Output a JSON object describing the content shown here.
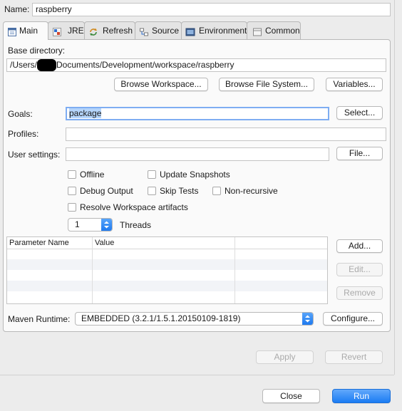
{
  "name": {
    "label": "Name:",
    "value": "raspberry"
  },
  "tabs": [
    {
      "label": "Main",
      "icon": "main-tab-icon"
    },
    {
      "label": "JRE",
      "icon": "jre-icon"
    },
    {
      "label": "Refresh",
      "icon": "refresh-icon"
    },
    {
      "label": "Source",
      "icon": "source-icon"
    },
    {
      "label": "Environment",
      "icon": "environment-icon"
    },
    {
      "label": "Common",
      "icon": "common-icon"
    }
  ],
  "base_dir": {
    "label": "Base directory:",
    "value_prefix": "/Users/",
    "value_suffix": "Documents/Development/workspace/raspberry"
  },
  "base_buttons": {
    "workspace": "Browse Workspace...",
    "filesystem": "Browse File System...",
    "variables": "Variables..."
  },
  "goals": {
    "label": "Goals:",
    "value": "package",
    "button": "Select..."
  },
  "profiles": {
    "label": "Profiles:",
    "value": ""
  },
  "user_settings": {
    "label": "User settings:",
    "value": "",
    "button": "File..."
  },
  "options": {
    "offline": "Offline",
    "update_snapshots": "Update Snapshots",
    "debug_output": "Debug Output",
    "skip_tests": "Skip Tests",
    "non_recursive": "Non-recursive",
    "resolve_workspace": "Resolve Workspace artifacts"
  },
  "threads": {
    "value": "1",
    "label": "Threads"
  },
  "params_table": {
    "columns": [
      "Parameter Name",
      "Value"
    ],
    "rows": []
  },
  "param_buttons": {
    "add": "Add...",
    "edit": "Edit...",
    "remove": "Remove"
  },
  "runtime": {
    "label": "Maven Runtime:",
    "value": "EMBEDDED (3.2.1/1.5.1.20150109-1819)",
    "button": "Configure..."
  },
  "footer": {
    "apply": "Apply",
    "revert": "Revert",
    "close": "Close",
    "run": "Run"
  },
  "colors": {
    "accent": "#1b7cf3",
    "selection": "#b5d5fb"
  }
}
